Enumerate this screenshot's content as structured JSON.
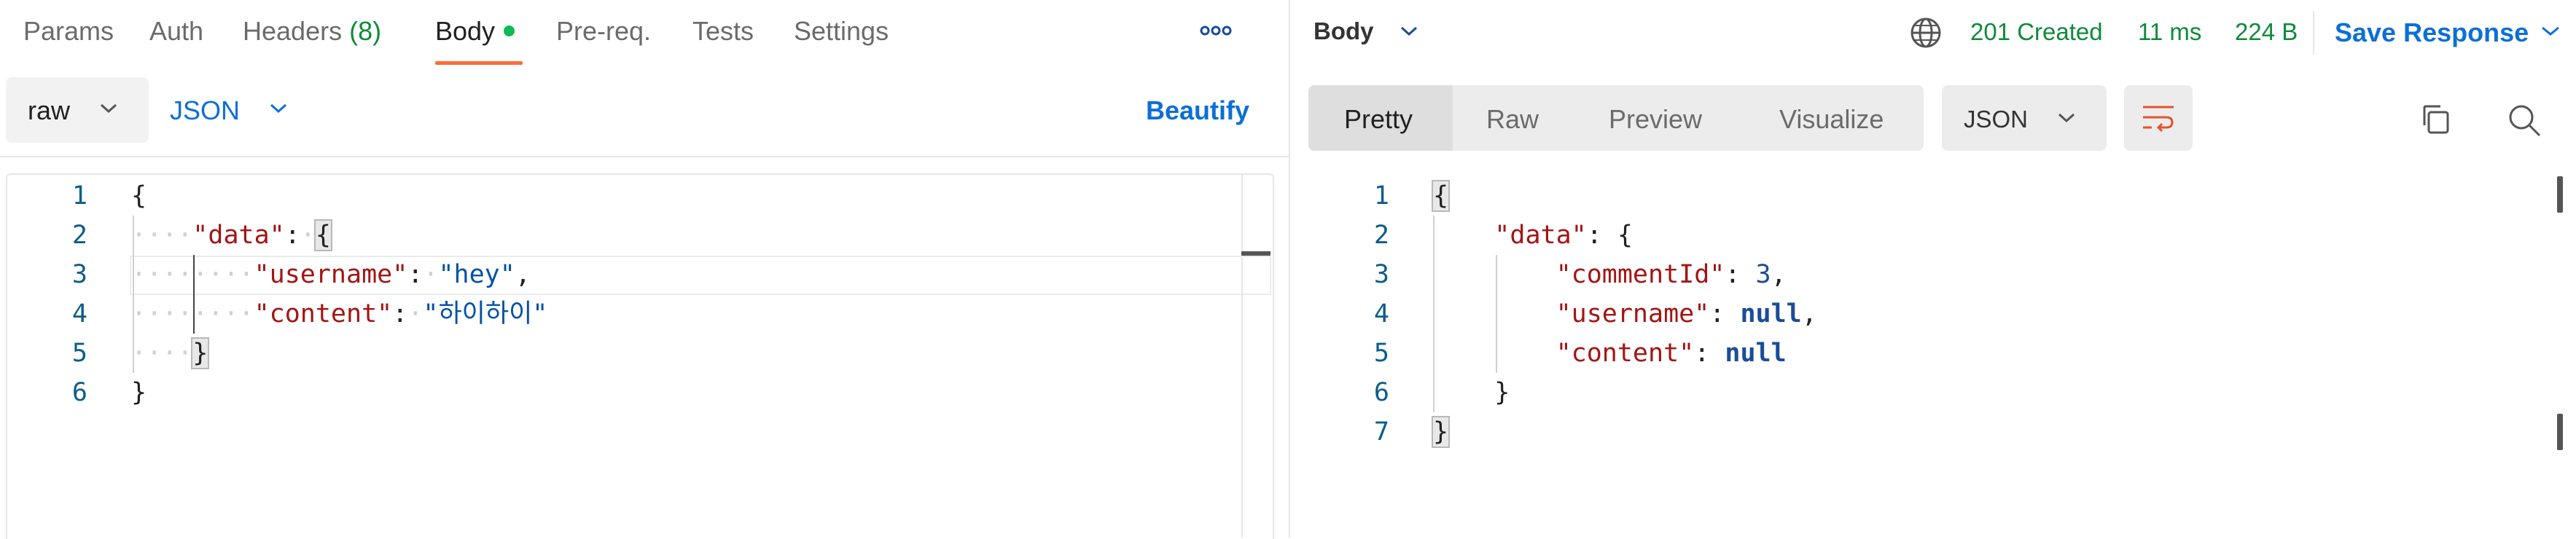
{
  "request": {
    "tabs": [
      {
        "label": "Params"
      },
      {
        "label": "Auth"
      },
      {
        "label": "Headers",
        "count": "(8)"
      },
      {
        "label": "Body",
        "active": true
      },
      {
        "label": "Pre-req."
      },
      {
        "label": "Tests"
      },
      {
        "label": "Settings"
      }
    ],
    "more_icon": "more-horizontal-icon",
    "body_mode": "raw",
    "body_format": "JSON",
    "beautify_label": "Beautify",
    "editor_lines": [
      "1",
      "2",
      "3",
      "4",
      "5",
      "6"
    ],
    "code": {
      "open_brace": "{",
      "data_key": "\"data\"",
      "username_key": "\"username\"",
      "username_value": "\"hey\"",
      "content_key": "\"content\"",
      "content_value": "\"하이하이\"",
      "close_inner": "}",
      "close_outer": "}"
    }
  },
  "response": {
    "section_label": "Body",
    "status": "201 Created",
    "time": "11 ms",
    "size": "224 B",
    "save_label": "Save Response",
    "view_tabs": [
      "Pretty",
      "Raw",
      "Preview",
      "Visualize"
    ],
    "active_view": "Pretty",
    "format": "JSON",
    "editor_lines": [
      "1",
      "2",
      "3",
      "4",
      "5",
      "6",
      "7"
    ],
    "code": {
      "open_brace": "{",
      "data_key": "\"data\"",
      "commentId_key": "\"commentId\"",
      "commentId_value": "3",
      "username_key": "\"username\"",
      "username_value": "null",
      "content_key": "\"content\"",
      "content_value": "null",
      "close_inner": "}",
      "close_outer": "}"
    }
  },
  "colors": {
    "accent_orange": "#ff6c37",
    "link_blue": "#0d6fd6",
    "success_green": "#0f8a3a",
    "active_dot": "#0cbb52"
  },
  "icons": [
    "globe-icon",
    "chevron-down-icon",
    "copy-icon",
    "search-icon",
    "wrap-lines-icon"
  ]
}
